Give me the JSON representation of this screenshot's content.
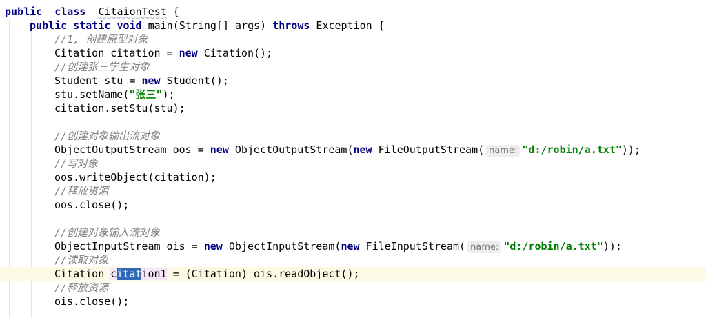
{
  "editor": {
    "lines": [
      {
        "tokens": [
          [
            "kw",
            "public"
          ],
          [
            "",
            "  "
          ],
          [
            "kw",
            "class"
          ],
          [
            "",
            "  "
          ],
          [
            "",
            ""
          ],
          [
            "wavy",
            "CitaionTest"
          ],
          [
            "",
            " {"
          ]
        ]
      },
      {
        "tokens": [
          [
            "kw",
            "public"
          ],
          [
            "",
            " "
          ],
          [
            "kw",
            "static"
          ],
          [
            "",
            " "
          ],
          [
            "kw",
            "void"
          ],
          [
            "",
            " main(String[] args) "
          ],
          [
            "kw",
            "throws"
          ],
          [
            "",
            " Exception {"
          ]
        ]
      },
      {
        "tokens": [
          [
            "cm",
            "//1, 创建原型对象"
          ]
        ]
      },
      {
        "tokens": [
          [
            "",
            "Citation citation = "
          ],
          [
            "kw",
            "new"
          ],
          [
            "",
            " Citation();"
          ]
        ]
      },
      {
        "tokens": [
          [
            "cm",
            "//创建张三学生对象"
          ]
        ]
      },
      {
        "tokens": [
          [
            "",
            "Student stu = "
          ],
          [
            "kw",
            "new"
          ],
          [
            "",
            " Student();"
          ]
        ]
      },
      {
        "tokens": [
          [
            "",
            "stu.setName("
          ],
          [
            "st",
            "\"张三\""
          ],
          [
            "",
            ");"
          ]
        ]
      },
      {
        "tokens": [
          [
            "",
            "citation.setStu(stu);"
          ]
        ]
      },
      {
        "tokens": []
      },
      {
        "tokens": [
          [
            "cm",
            "//创建对象输出流对象"
          ]
        ]
      },
      {
        "tokens": [
          [
            "",
            "ObjectOutputStream oos = "
          ],
          [
            "kw",
            "new"
          ],
          [
            "",
            " ObjectOutputStream("
          ],
          [
            "kw",
            "new"
          ],
          [
            "",
            " FileOutputStream("
          ],
          [
            "hint",
            "name:"
          ],
          [
            "st",
            "\"d:/robin/a.txt\""
          ],
          [
            "",
            "));"
          ]
        ]
      },
      {
        "tokens": [
          [
            "cm",
            "//写对象"
          ]
        ]
      },
      {
        "tokens": [
          [
            "",
            "oos.writeObject(citation);"
          ]
        ]
      },
      {
        "tokens": [
          [
            "cm",
            "//释放资源"
          ]
        ]
      },
      {
        "tokens": [
          [
            "",
            "oos.close();"
          ]
        ]
      },
      {
        "tokens": []
      },
      {
        "tokens": [
          [
            "cm",
            "//创建对象输入流对象"
          ]
        ]
      },
      {
        "tokens": [
          [
            "",
            "ObjectInputStream ois = "
          ],
          [
            "kw",
            "new"
          ],
          [
            "",
            " ObjectInputStream("
          ],
          [
            "kw",
            "new"
          ],
          [
            "",
            " FileInputStream("
          ],
          [
            "hint",
            "name:"
          ],
          [
            "st",
            "\"d:/robin/a.txt\""
          ],
          [
            "",
            "));"
          ]
        ]
      },
      {
        "tokens": [
          [
            "cm",
            "//读取对象"
          ]
        ]
      },
      {
        "tokens": [
          [
            "",
            "Citation "
          ],
          [
            "identpre",
            "c"
          ],
          [
            "sel",
            "itat"
          ],
          [
            "caret",
            ""
          ],
          [
            "identpost",
            "ion1"
          ],
          [
            "",
            " = (Citation) ois.readObject();"
          ]
        ]
      },
      {
        "tokens": [
          [
            "cm",
            "//释放资源"
          ]
        ]
      },
      {
        "tokens": [
          [
            "",
            "ois.close();"
          ]
        ]
      }
    ]
  }
}
